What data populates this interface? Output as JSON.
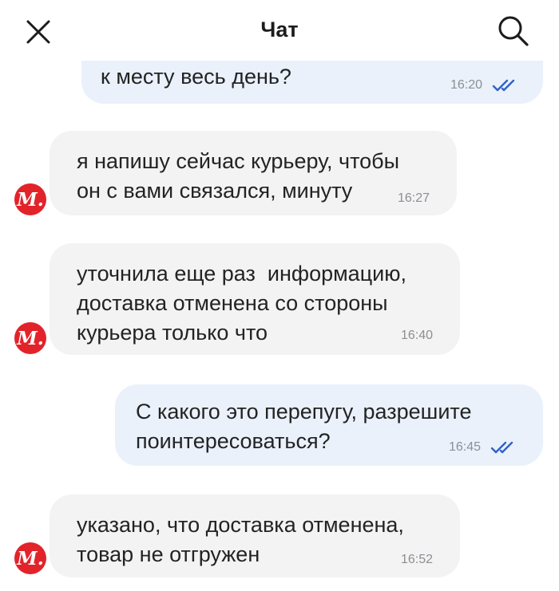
{
  "header": {
    "title": "Чат",
    "close_icon": "close-icon",
    "search_icon": "search-icon"
  },
  "avatar": {
    "label": "М.",
    "color": "#e2232a"
  },
  "colors": {
    "incoming_bubble": "#f3f3f4",
    "outgoing_bubble": "#eaf1fb",
    "read_ticks": "#2f62c9"
  },
  "messages": [
    {
      "direction": "outgoing",
      "text": "к месту весь день?",
      "time": "16:20",
      "status": "read"
    },
    {
      "direction": "incoming",
      "text": "я напишу сейчас курьеру, чтобы\nон с вами связался, минуту",
      "time": "16:27"
    },
    {
      "direction": "incoming",
      "text": "уточнила еще раз  информацию,\nдоставка отменена со стороны\nкурьера только что",
      "time": "16:40"
    },
    {
      "direction": "outgoing",
      "text": "С какого это перепугу, разрешите\nпоинтересоваться?",
      "time": "16:45",
      "status": "read"
    },
    {
      "direction": "incoming",
      "text": "указано, что доставка отменена,\nтовар не отгружен",
      "time": "16:52"
    }
  ]
}
